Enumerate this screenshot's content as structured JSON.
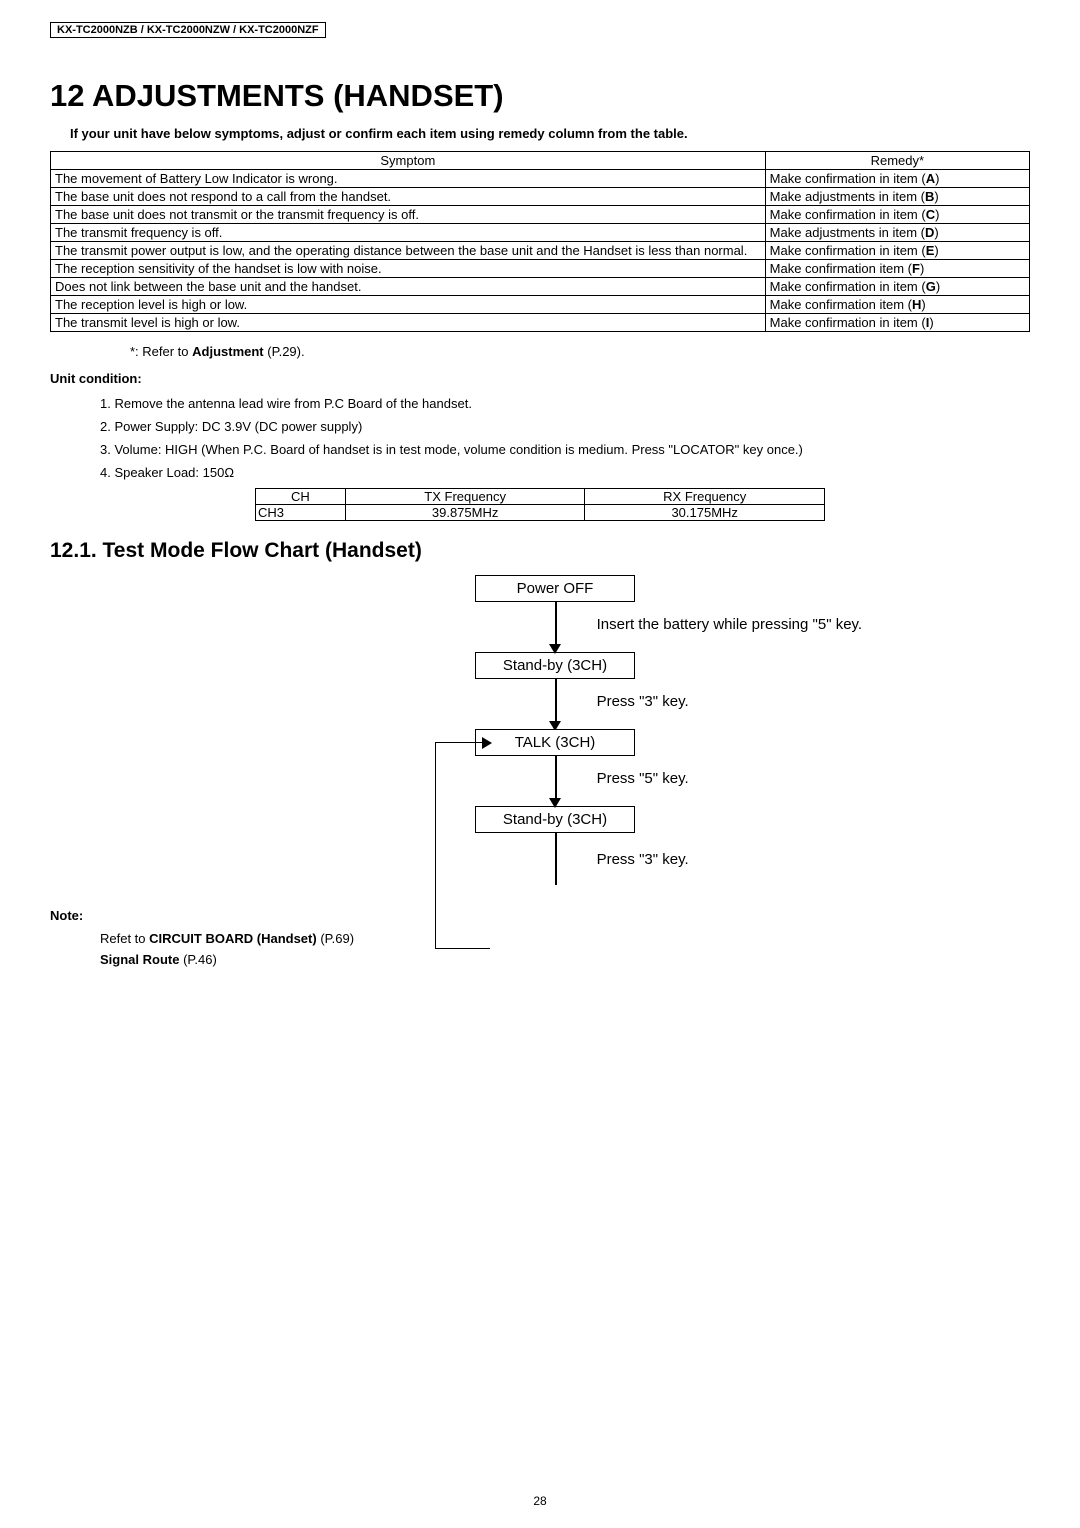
{
  "header": "KX-TC2000NZB / KX-TC2000NZW / KX-TC2000NZF",
  "title": "12 ADJUSTMENTS (HANDSET)",
  "intro": "If your unit have below symptoms, adjust or confirm each item using remedy column from the table.",
  "symptom_table": {
    "headers": [
      "Symptom",
      "Remedy*"
    ],
    "rows": [
      [
        "The movement of Battery Low Indicator is wrong.",
        "Make confirmation in item (A)"
      ],
      [
        "The base unit does not respond to a call from the handset.",
        "Make adjustments in item (B)"
      ],
      [
        "The base unit does not transmit or the transmit frequency is off.",
        "Make confirmation in item (C)"
      ],
      [
        "The transmit frequency is off.",
        "Make adjustments in item (D)"
      ],
      [
        "The transmit power output is low, and the operating distance between the base unit and the Handset is less than normal.",
        "Make confirmation in item (E)"
      ],
      [
        "The reception sensitivity of the handset is low with noise.",
        "Make confirmation item (F)"
      ],
      [
        "Does not link between the base unit and the handset.",
        "Make confirmation in item (G)"
      ],
      [
        "The reception level is high or low.",
        "Make confirmation item (H)"
      ],
      [
        "The transmit level is high or low.",
        "Make confirmation in item (I)"
      ]
    ],
    "bold_letters": [
      "A",
      "B",
      "C",
      "D",
      "E",
      "F",
      "G",
      "H",
      "I"
    ]
  },
  "footnote_prefix": "*: Refer to ",
  "footnote_bold": "Adjustment",
  "footnote_suffix": " (P.29).",
  "unit_condition_title": "Unit condition:",
  "conditions": [
    "1. Remove the antenna lead wire from P.C Board of the handset.",
    "2.  Power Supply: DC 3.9V (DC power supply)",
    "3. Volume: HIGH (When P.C. Board of handset is in test mode, volume condition is medium. Press \"LOCATOR\" key once.)",
    "4. Speaker Load: 150Ω"
  ],
  "freq_table": {
    "headers": [
      "CH",
      "TX Frequency",
      "RX Frequency"
    ],
    "rows": [
      [
        "CH3",
        "39.875MHz",
        "30.175MHz"
      ]
    ]
  },
  "section_title": "12.1.  Test Mode Flow Chart (Handset)",
  "flowchart": {
    "boxes": [
      "Power OFF",
      "Stand-by (3CH)",
      "TALK (3CH)",
      "Stand-by (3CH)"
    ],
    "labels": [
      "Insert the battery while pressing \"5\" key.",
      "Press \"3\" key.",
      "Press \"5\" key.",
      "Press \"3\" key."
    ]
  },
  "note_title": "Note:",
  "note_lines": [
    {
      "prefix": "Refet to ",
      "bold": "CIRCUIT BOARD (Handset)",
      "suffix": " (P.69)"
    },
    {
      "prefix": "",
      "bold": "Signal Route",
      "suffix": " (P.46)"
    }
  ],
  "page_number": "28"
}
